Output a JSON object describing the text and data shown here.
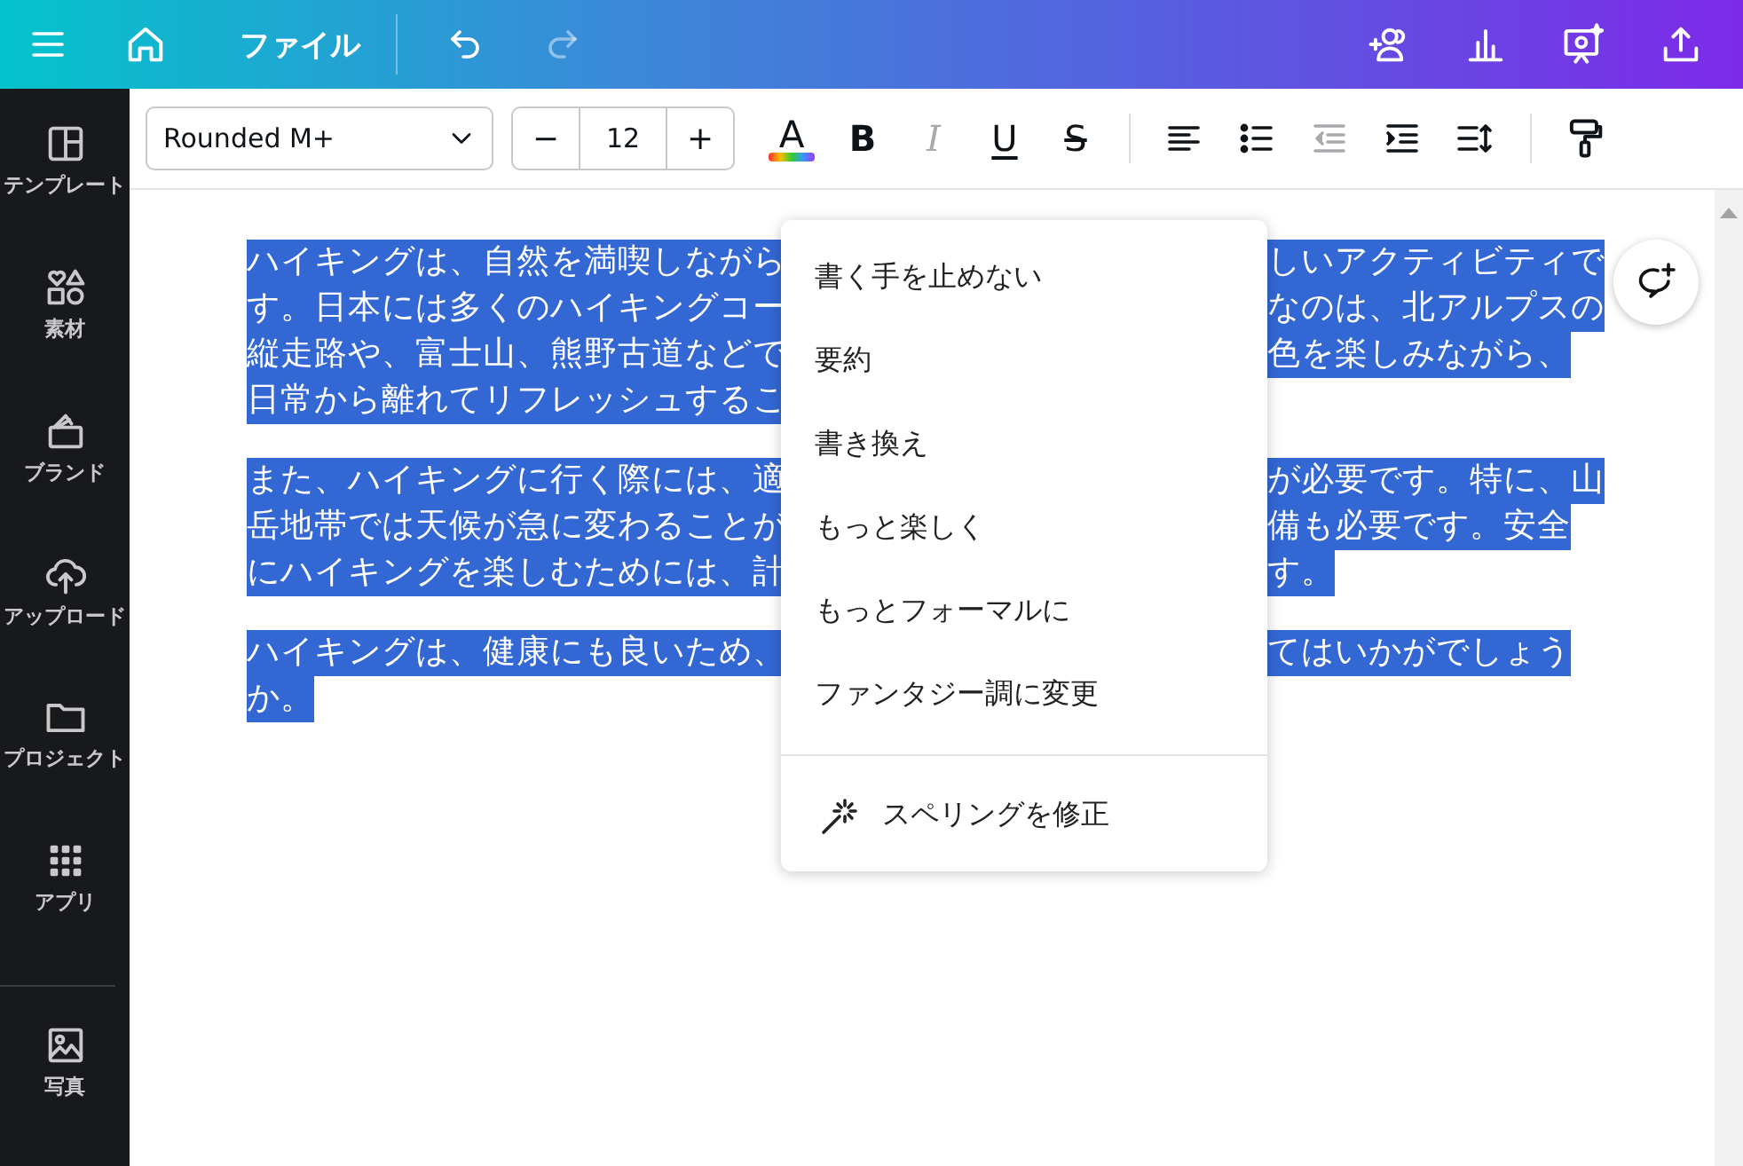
{
  "top_bar": {
    "file_label": "ファイル",
    "history_buttons": [
      {
        "kind": "undo",
        "disabled": false
      },
      {
        "kind": "redo",
        "disabled": true
      }
    ]
  },
  "sidebar": {
    "items": [
      {
        "kind": "templates",
        "label": "テンプレート"
      },
      {
        "kind": "elements",
        "label": "素材"
      },
      {
        "kind": "brand",
        "label": "ブランド"
      },
      {
        "kind": "uploads",
        "label": "アップロード"
      },
      {
        "kind": "projects",
        "label": "プロジェクト"
      },
      {
        "kind": "apps",
        "label": "アプリ"
      }
    ],
    "more_items": [
      {
        "kind": "photos",
        "label": "写真"
      }
    ]
  },
  "toolbar": {
    "font": "Rounded M+",
    "decrement": "−",
    "font_size": "12",
    "increment": "+",
    "format_buttons": [
      {
        "kind": "text-color",
        "label": "A",
        "disabled": false
      },
      {
        "kind": "bold",
        "label": "B",
        "disabled": false
      },
      {
        "kind": "italic",
        "label": "I",
        "disabled": true
      },
      {
        "kind": "underline",
        "label": "U",
        "disabled": false
      },
      {
        "kind": "strikethrough",
        "label": "S",
        "disabled": false
      }
    ],
    "paragraph_buttons": [
      {
        "kind": "align-left",
        "disabled": false
      },
      {
        "kind": "bullets",
        "disabled": false
      },
      {
        "kind": "outdent",
        "disabled": true
      },
      {
        "kind": "indent",
        "disabled": false
      },
      {
        "kind": "spacing",
        "disabled": false
      }
    ]
  },
  "document": {
    "selected": true,
    "paragraphs": [
      {
        "lines": [
          {
            "left": "ハイキングは、自然を満喫しながら",
            "right": "しいアクティビティで"
          },
          {
            "left": "す。日本には多くのハイキングコー",
            "right": "なのは、北アルプスの"
          },
          {
            "left": "縦走路や、富士山、熊野古道などで",
            "right": "色を楽しみながら、"
          },
          {
            "left": "日常から離れてリフレッシュするこ"
          }
        ]
      },
      {
        "lines": [
          {
            "left": "また、ハイキングに行く際には、適",
            "right": "が必要です。特に、山"
          },
          {
            "left": "岳地帯では天候が急に変わることが",
            "right": "備も必要です。安全"
          },
          {
            "left": "にハイキングを楽しむためには、計",
            "right": "す。"
          }
        ]
      },
      {
        "lines": [
          {
            "left": "ハイキングは、健康にも良いため、",
            "right": "てはいかがでしょう"
          },
          {
            "left": "か。"
          }
        ]
      }
    ]
  },
  "context_menu": {
    "items": [
      {
        "kind": "option",
        "label": "書く手を止めない"
      },
      {
        "kind": "option",
        "label": "要約"
      },
      {
        "kind": "option",
        "label": "書き換え"
      },
      {
        "kind": "option",
        "label": "もっと楽しく"
      },
      {
        "kind": "option",
        "label": "もっとフォーマルに"
      },
      {
        "kind": "option",
        "label": "ファンタジー調に変更"
      },
      {
        "kind": "action",
        "label": "スペリングを修正"
      }
    ]
  }
}
